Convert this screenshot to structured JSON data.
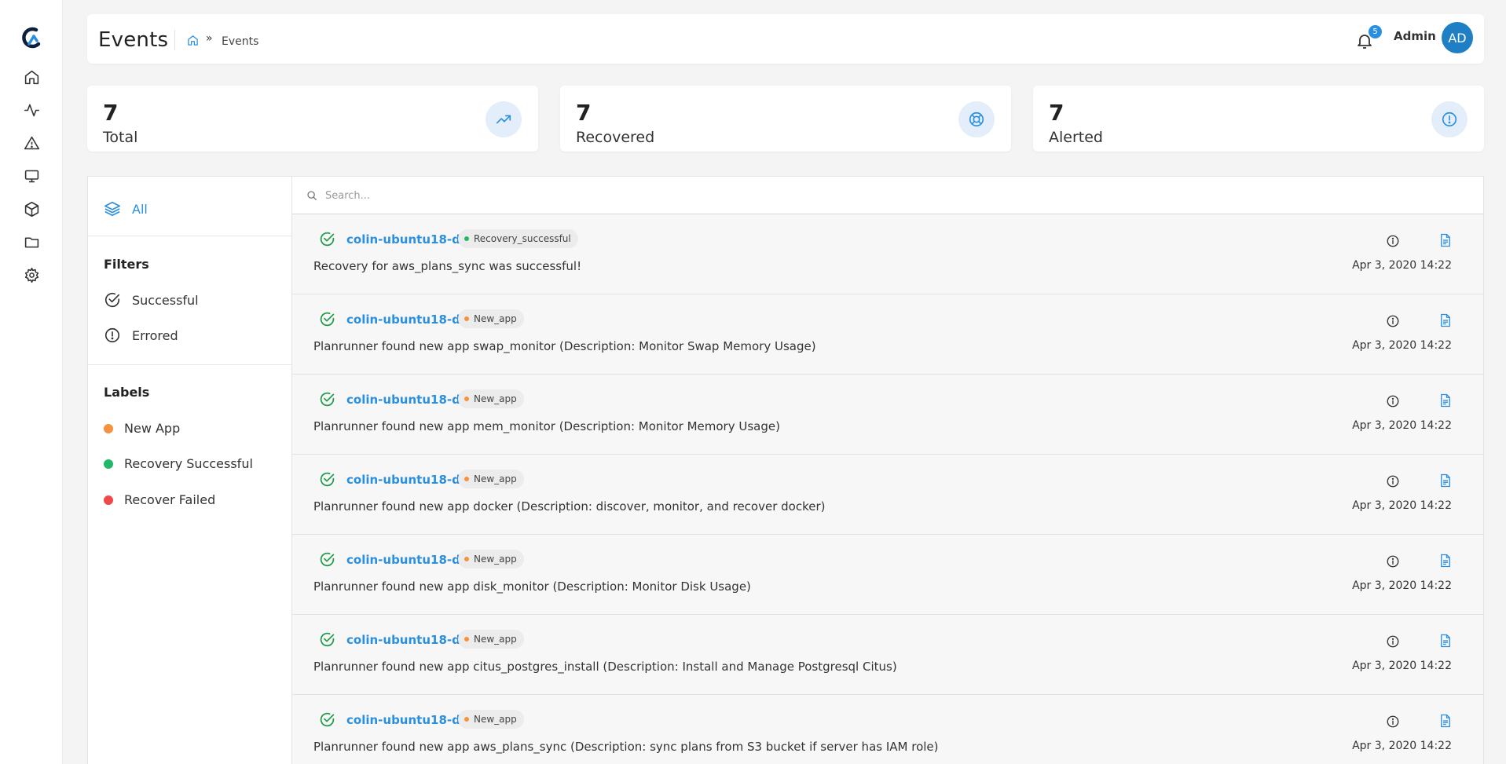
{
  "header": {
    "title": "Events",
    "breadcrumb": {
      "home_icon": "home-icon",
      "separator": "»",
      "current": "Events"
    },
    "notifications": {
      "count": "5"
    },
    "user": {
      "name": "Admin",
      "initials": "AD"
    }
  },
  "sidebar": {
    "logo": "app-logo",
    "items": [
      {
        "name": "home",
        "icon": "home-icon"
      },
      {
        "name": "activity",
        "icon": "activity-icon"
      },
      {
        "name": "alerts",
        "icon": "alert-triangle-icon"
      },
      {
        "name": "monitors",
        "icon": "monitor-icon"
      },
      {
        "name": "packages",
        "icon": "box-icon"
      },
      {
        "name": "files",
        "icon": "folder-icon"
      },
      {
        "name": "settings",
        "icon": "gear-icon"
      }
    ]
  },
  "stats": [
    {
      "value": "7",
      "label": "Total",
      "icon": "trending-up-icon"
    },
    {
      "value": "7",
      "label": "Recovered",
      "icon": "life-buoy-icon"
    },
    {
      "value": "7",
      "label": "Alerted",
      "icon": "alert-circle-icon"
    }
  ],
  "filters": {
    "all_label": "All",
    "filters_title": "Filters",
    "items": [
      {
        "label": "Successful",
        "icon": "check-circle-icon"
      },
      {
        "label": "Errored",
        "icon": "alert-circle-icon"
      }
    ],
    "labels_title": "Labels",
    "labels": [
      {
        "label": "New App",
        "color": "#f5923e"
      },
      {
        "label": "Recovery Successful",
        "color": "#1fb868"
      },
      {
        "label": "Recover Failed",
        "color": "#f04848"
      }
    ]
  },
  "search": {
    "placeholder": "Search..."
  },
  "colors": {
    "accent": "#2b8fe0",
    "success": "#1f9d4a",
    "new_app": "#f5923e",
    "recovery_successful": "#1fb868"
  },
  "events": [
    {
      "host": "colin-ubuntu18-db",
      "tag": "Recovery_successful",
      "tag_color": "#1fb868",
      "message": "Recovery for aws_plans_sync was successful!",
      "time": "Apr 3, 2020 14:22"
    },
    {
      "host": "colin-ubuntu18-db",
      "tag": "New_app",
      "tag_color": "#f5923e",
      "message": "Planrunner found new app swap_monitor (Description: Monitor Swap Memory Usage)",
      "time": "Apr 3, 2020 14:22"
    },
    {
      "host": "colin-ubuntu18-db",
      "tag": "New_app",
      "tag_color": "#f5923e",
      "message": "Planrunner found new app mem_monitor (Description: Monitor Memory Usage)",
      "time": "Apr 3, 2020 14:22"
    },
    {
      "host": "colin-ubuntu18-db",
      "tag": "New_app",
      "tag_color": "#f5923e",
      "message": "Planrunner found new app docker (Description: discover, monitor, and recover docker)",
      "time": "Apr 3, 2020 14:22"
    },
    {
      "host": "colin-ubuntu18-db",
      "tag": "New_app",
      "tag_color": "#f5923e",
      "message": "Planrunner found new app disk_monitor (Description: Monitor Disk Usage)",
      "time": "Apr 3, 2020 14:22"
    },
    {
      "host": "colin-ubuntu18-db",
      "tag": "New_app",
      "tag_color": "#f5923e",
      "message": "Planrunner found new app citus_postgres_install (Description: Install and Manage Postgresql Citus)",
      "time": "Apr 3, 2020 14:22"
    },
    {
      "host": "colin-ubuntu18-db",
      "tag": "New_app",
      "tag_color": "#f5923e",
      "message": "Planrunner found new app aws_plans_sync (Description: sync plans from S3 bucket if server has IAM role)",
      "time": "Apr 3, 2020 14:22"
    }
  ]
}
